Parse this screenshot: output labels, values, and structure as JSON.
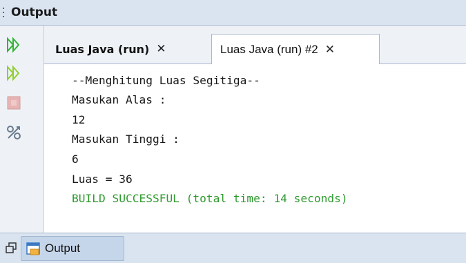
{
  "window": {
    "title": "Output"
  },
  "toolbar": {
    "buttons": [
      {
        "name": "rerun",
        "icon": "double-play-icon"
      },
      {
        "name": "rerun-with-params",
        "icon": "double-play-icon"
      },
      {
        "name": "stop",
        "icon": "stop-icon"
      },
      {
        "name": "settings",
        "icon": "settings-icon"
      }
    ]
  },
  "tabs": [
    {
      "label": "Luas Java (run)",
      "close": "✕",
      "active": false
    },
    {
      "label": "Luas Java (run) #2",
      "close": "✕",
      "active": true
    }
  ],
  "console": {
    "lines": [
      "--Menghitung Luas Segitiga--",
      "Masukan Alas :",
      "12",
      "Masukan Tinggi :",
      "6",
      "Luas = 36"
    ],
    "status": "BUILD SUCCESSFUL (total time: 14 seconds)"
  },
  "bottom": {
    "tab_label": "Output"
  },
  "colors": {
    "accent_green": "#34b335",
    "success_text": "#2f9a2f",
    "header_bg": "#dae4f0",
    "stop_red": "#e06b6b"
  }
}
